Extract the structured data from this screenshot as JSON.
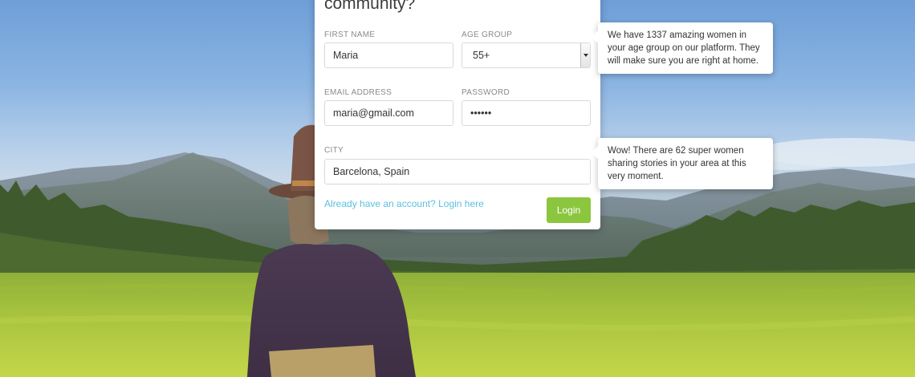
{
  "form": {
    "heading": "community?",
    "first_name": {
      "label": "FIRST NAME",
      "value": "Maria"
    },
    "age_group": {
      "label": "AGE GROUP",
      "value": "55+"
    },
    "email": {
      "label": "EMAIL ADDRESS",
      "value": "maria@gmail.com"
    },
    "password": {
      "label": "PASSWORD",
      "value": "••••••"
    },
    "city": {
      "label": "CITY",
      "value": "Barcelona, Spain"
    },
    "login_link": "Already have an account? Login here",
    "login_button": "Login"
  },
  "tooltips": {
    "age": "We have 1337 amazing women in your age group on our platform. They will make sure you are right at home.",
    "city": "Wow! There are 62 super women sharing stories in your area at this very moment."
  },
  "colors": {
    "accent_green": "#8cc63f",
    "link_blue": "#5bc0de",
    "label_gray": "#8a8a8a"
  },
  "icons": {
    "select_arrow": "chevron-down-icon"
  }
}
